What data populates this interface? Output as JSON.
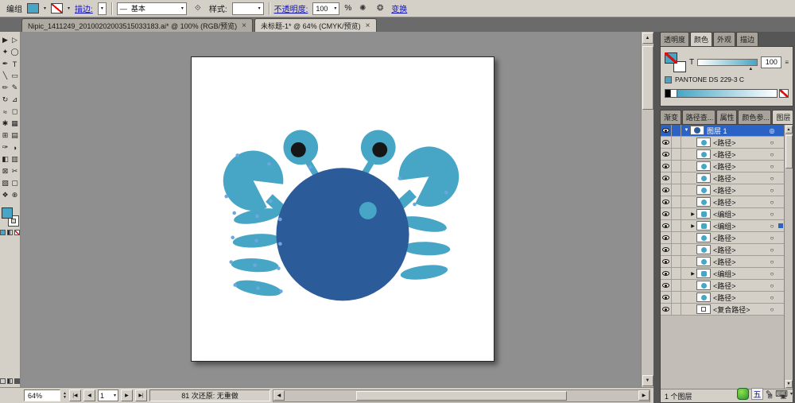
{
  "control_bar": {
    "context_label": "编组",
    "stroke_label": "描边:",
    "brush_dash": "—",
    "brush_name": "基本",
    "style_label": "样式:",
    "opacity_label": "不透明度:",
    "opacity_value": "100",
    "percent": "%",
    "transform_label": "变换"
  },
  "doc_tabs": [
    {
      "title": "Nipic_1411249_20100202003515033183.ai* @ 100% (RGB/预览)"
    },
    {
      "title": "未标题-1* @ 64% (CMYK/预览)"
    }
  ],
  "tools": [
    {
      "name": "selection-tool",
      "glyph": "▶"
    },
    {
      "name": "direct-selection-tool",
      "glyph": "▷"
    },
    {
      "name": "magic-wand-tool",
      "glyph": "✦"
    },
    {
      "name": "lasso-tool",
      "glyph": "◯"
    },
    {
      "name": "pen-tool",
      "glyph": "✒"
    },
    {
      "name": "type-tool",
      "glyph": "T"
    },
    {
      "name": "line-segment-tool",
      "glyph": "╲"
    },
    {
      "name": "rectangle-tool",
      "glyph": "▭"
    },
    {
      "name": "paintbrush-tool",
      "glyph": "✏"
    },
    {
      "name": "pencil-tool",
      "glyph": "✎"
    },
    {
      "name": "rotate-tool",
      "glyph": "↻"
    },
    {
      "name": "scale-tool",
      "glyph": "⊿"
    },
    {
      "name": "warp-tool",
      "glyph": "≈"
    },
    {
      "name": "free-transform-tool",
      "glyph": "◻"
    },
    {
      "name": "symbol-sprayer-tool",
      "glyph": "✱"
    },
    {
      "name": "graph-tool",
      "glyph": "▦"
    },
    {
      "name": "mesh-tool",
      "glyph": "⊞"
    },
    {
      "name": "gradient-tool",
      "glyph": "▤"
    },
    {
      "name": "eyedropper-tool",
      "glyph": "✑"
    },
    {
      "name": "blend-tool",
      "glyph": "◑"
    },
    {
      "name": "live-paint-bucket-tool",
      "glyph": "◧"
    },
    {
      "name": "live-paint-selection-tool",
      "glyph": "▥"
    },
    {
      "name": "crop-area-tool",
      "glyph": "⊠"
    },
    {
      "name": "scissors-tool",
      "glyph": "✂"
    },
    {
      "name": "slice-tool",
      "glyph": "▧"
    },
    {
      "name": "artboard-tool",
      "glyph": "▢"
    },
    {
      "name": "hand-tool",
      "glyph": "❖"
    },
    {
      "name": "zoom-tool",
      "glyph": "⊕"
    }
  ],
  "color_panel": {
    "tabs": [
      {
        "label": "透明度"
      },
      {
        "label": "颜色"
      },
      {
        "label": "外观"
      },
      {
        "label": "描边"
      }
    ],
    "type_label": "T",
    "value": "100",
    "swatch_name": "PANTONE DS 229-3 C"
  },
  "layers_panel": {
    "tabs": [
      {
        "label": "渐变"
      },
      {
        "label": "路径查..."
      },
      {
        "label": "属性"
      },
      {
        "label": "颜色参..."
      },
      {
        "label": "图层"
      }
    ],
    "rows": [
      {
        "label": "图层 1",
        "kind": "layer",
        "eye": true,
        "expander": "down",
        "selected": true,
        "sel_dot": false
      },
      {
        "label": "<路径>",
        "kind": "path",
        "eye": true,
        "expander": "none",
        "selected": false,
        "sel_dot": false
      },
      {
        "label": "<路径>",
        "kind": "path",
        "eye": true,
        "expander": "none",
        "selected": false,
        "sel_dot": false
      },
      {
        "label": "<路径>",
        "kind": "path",
        "eye": true,
        "expander": "none",
        "selected": false,
        "sel_dot": false
      },
      {
        "label": "<路径>",
        "kind": "path",
        "eye": true,
        "expander": "none",
        "selected": false,
        "sel_dot": false
      },
      {
        "label": "<路径>",
        "kind": "path",
        "eye": true,
        "expander": "none",
        "selected": false,
        "sel_dot": false
      },
      {
        "label": "<路径>",
        "kind": "path",
        "eye": true,
        "expander": "none",
        "selected": false,
        "sel_dot": false
      },
      {
        "label": "<编组>",
        "kind": "group",
        "eye": true,
        "expander": "right",
        "selected": false,
        "sel_dot": false
      },
      {
        "label": "<编组>",
        "kind": "group",
        "eye": true,
        "expander": "right",
        "selected": false,
        "sel_dot": true
      },
      {
        "label": "<路径>",
        "kind": "path",
        "eye": true,
        "expander": "none",
        "selected": false,
        "sel_dot": false
      },
      {
        "label": "<路径>",
        "kind": "path",
        "eye": true,
        "expander": "none",
        "selected": false,
        "sel_dot": false
      },
      {
        "label": "<路径>",
        "kind": "path",
        "eye": true,
        "expander": "none",
        "selected": false,
        "sel_dot": false
      },
      {
        "label": "<编组>",
        "kind": "group",
        "eye": true,
        "expander": "right",
        "selected": false,
        "sel_dot": false
      },
      {
        "label": "<路径>",
        "kind": "path",
        "eye": true,
        "expander": "none",
        "selected": false,
        "sel_dot": false
      },
      {
        "label": "<路径>",
        "kind": "path",
        "eye": true,
        "expander": "none",
        "selected": false,
        "sel_dot": false
      },
      {
        "label": "<复合路径>",
        "kind": "compound",
        "eye": true,
        "expander": "none",
        "selected": false,
        "sel_dot": false
      }
    ],
    "footer": "1 个图层"
  },
  "status_bar": {
    "zoom": "64%",
    "page": "1",
    "history": "81 次还原: 无重做"
  },
  "language_bar": {
    "ime_label": "五"
  },
  "artwork_colors": {
    "body": "#2b5c99",
    "limbs": "#47a6c5",
    "pupil": "#161616",
    "anchor": "#6aa7e3"
  }
}
